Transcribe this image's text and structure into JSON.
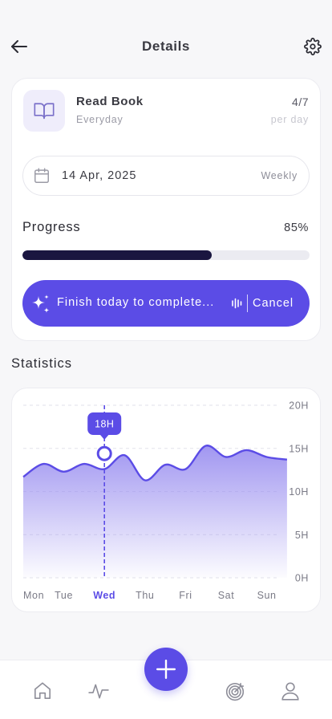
{
  "header": {
    "title": "Details",
    "back_icon": "arrow-left-icon",
    "settings_icon": "gear-icon"
  },
  "habit": {
    "icon": "book-open-icon",
    "name": "Read Book",
    "frequency": "Everyday",
    "count": "4/7",
    "unit": "per day"
  },
  "date_field": {
    "icon": "calendar-icon",
    "value": "14 Apr, 2025",
    "repeat": "Weekly"
  },
  "progress": {
    "label": "Progress",
    "value_text": "85%",
    "bar_fraction": 0.66
  },
  "action": {
    "icon": "sparkles-icon",
    "label": "Finish today to complete...",
    "cancel_icon": "audio-bars-icon",
    "cancel_label": "Cancel"
  },
  "statistics": {
    "heading": "Statistics"
  },
  "colors": {
    "accent": "#5B4CE6",
    "progress_fill": "#1A1640",
    "area_top": "#9C91F0"
  },
  "chart_data": {
    "type": "area",
    "x": [
      0,
      0.5,
      1,
      1.5,
      2,
      2.5,
      3,
      3.5,
      4,
      4.5,
      5,
      5.5,
      6,
      6.5
    ],
    "values": [
      11.7,
      13.2,
      12.3,
      13.2,
      12.6,
      14.2,
      11.3,
      13.1,
      12.6,
      15.3,
      14.0,
      14.8,
      14.0,
      13.7
    ],
    "categories": [
      "Mon",
      "Tue",
      "Wed",
      "Thu",
      "Fri",
      "Sat",
      "Sun"
    ],
    "selected_category": "Wed",
    "ylim": [
      0,
      20
    ],
    "ytick_labels": [
      "20H",
      "15H",
      "10H",
      "5H",
      "0H"
    ],
    "ytick_values": [
      20,
      15,
      10,
      5,
      0
    ],
    "highlight": {
      "x": 2,
      "y": 14.4,
      "label": "18H"
    },
    "grid": true,
    "legend": "none"
  },
  "tabbar": {
    "items": [
      {
        "name": "tab-home",
        "icon": "home-icon"
      },
      {
        "name": "tab-activity",
        "icon": "activity-pulse-icon"
      },
      {
        "name": "tab-goals",
        "icon": "target-icon"
      },
      {
        "name": "tab-profile",
        "icon": "user-icon"
      }
    ],
    "fab_icon": "plus-icon"
  }
}
